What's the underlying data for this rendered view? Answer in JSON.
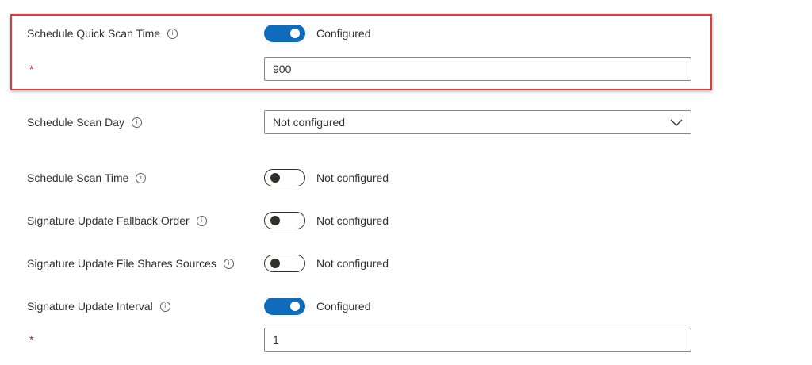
{
  "settings": {
    "quick_scan_time": {
      "label": "Schedule Quick Scan Time",
      "state": "Configured",
      "required_mark": "*",
      "value": "900"
    },
    "scan_day": {
      "label": "Schedule Scan Day",
      "selected": "Not configured"
    },
    "scan_time": {
      "label": "Schedule Scan Time",
      "state": "Not configured"
    },
    "fallback_order": {
      "label": "Signature Update Fallback Order",
      "state": "Not configured"
    },
    "file_shares": {
      "label": "Signature Update File Shares Sources",
      "state": "Not configured"
    },
    "update_interval": {
      "label": "Signature Update Interval",
      "state": "Configured",
      "required_mark": "*",
      "value": "1"
    }
  },
  "info_glyph": "i",
  "colors": {
    "toggle_on": "#0f6cbd",
    "highlight_border": "#e03b3b",
    "required": "#a4262c"
  }
}
